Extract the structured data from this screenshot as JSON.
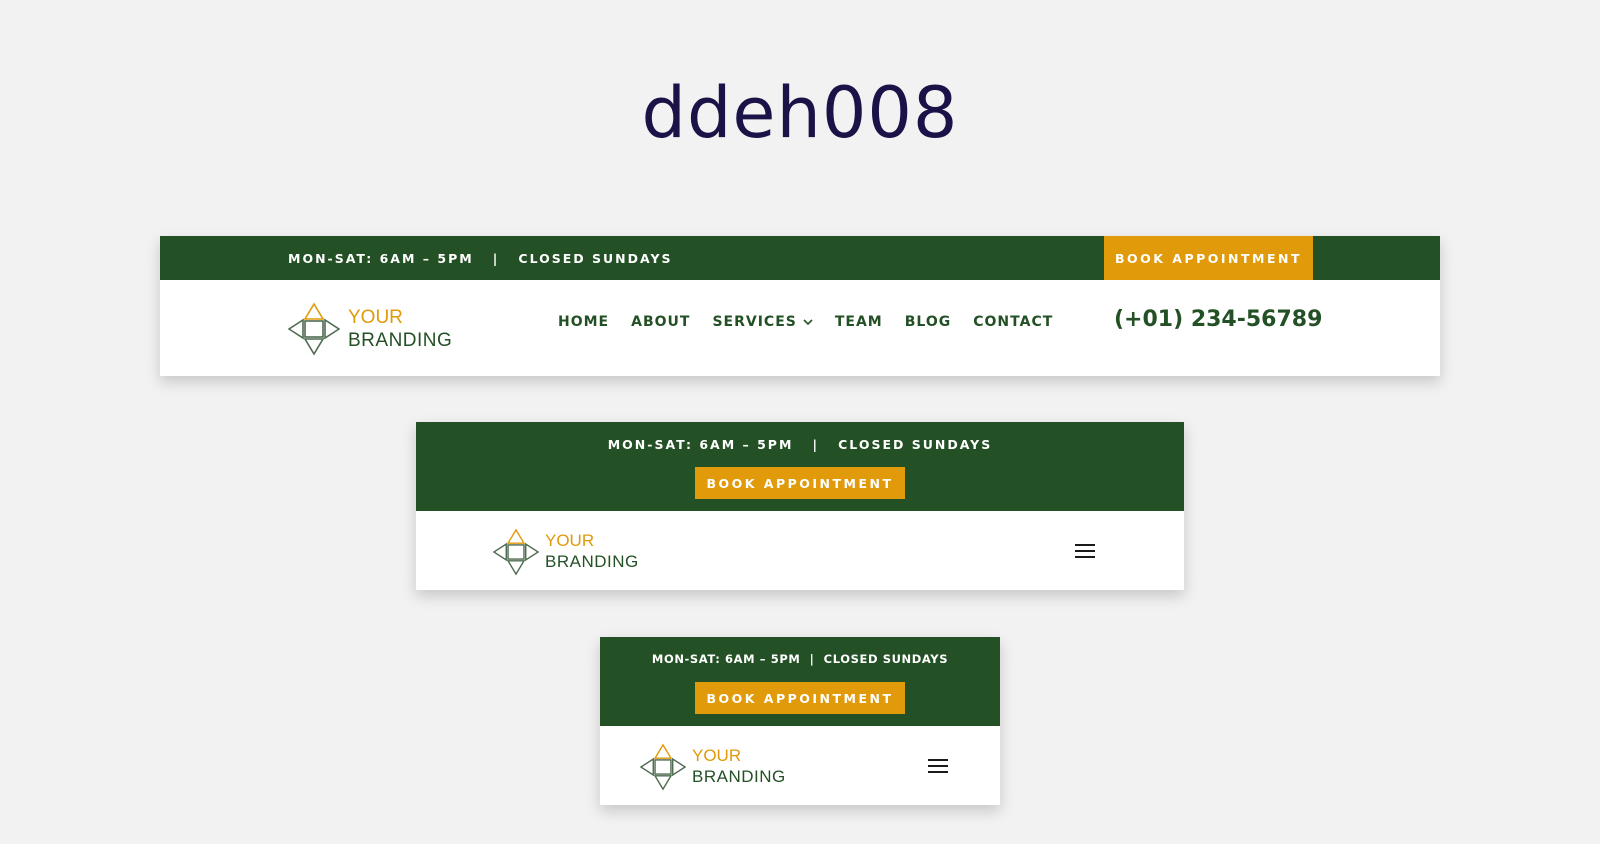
{
  "page": {
    "title": "ddeh008"
  },
  "header": {
    "hours": "MON-SAT: 6AM – 5PM",
    "separator": "|",
    "closed": "CLOSED SUNDAYS",
    "book_label": "BOOK APPOINTMENT",
    "logo_line1": "YOUR",
    "logo_line2": "BRANDING",
    "phone": "(+01) 234-56789",
    "nav": [
      {
        "label": "HOME"
      },
      {
        "label": "ABOUT"
      },
      {
        "label": "SERVICES",
        "has_dropdown": true
      },
      {
        "label": "TEAM"
      },
      {
        "label": "BLOG"
      },
      {
        "label": "CONTACT"
      }
    ]
  },
  "icons": {
    "logo": "diamond-logo-icon",
    "dropdown": "chevron-down-icon",
    "menu": "hamburger-menu-icon"
  },
  "colors": {
    "green": "#235024",
    "gold": "#e09a0a",
    "background": "#f2f2f2",
    "title": "#1b1248"
  }
}
